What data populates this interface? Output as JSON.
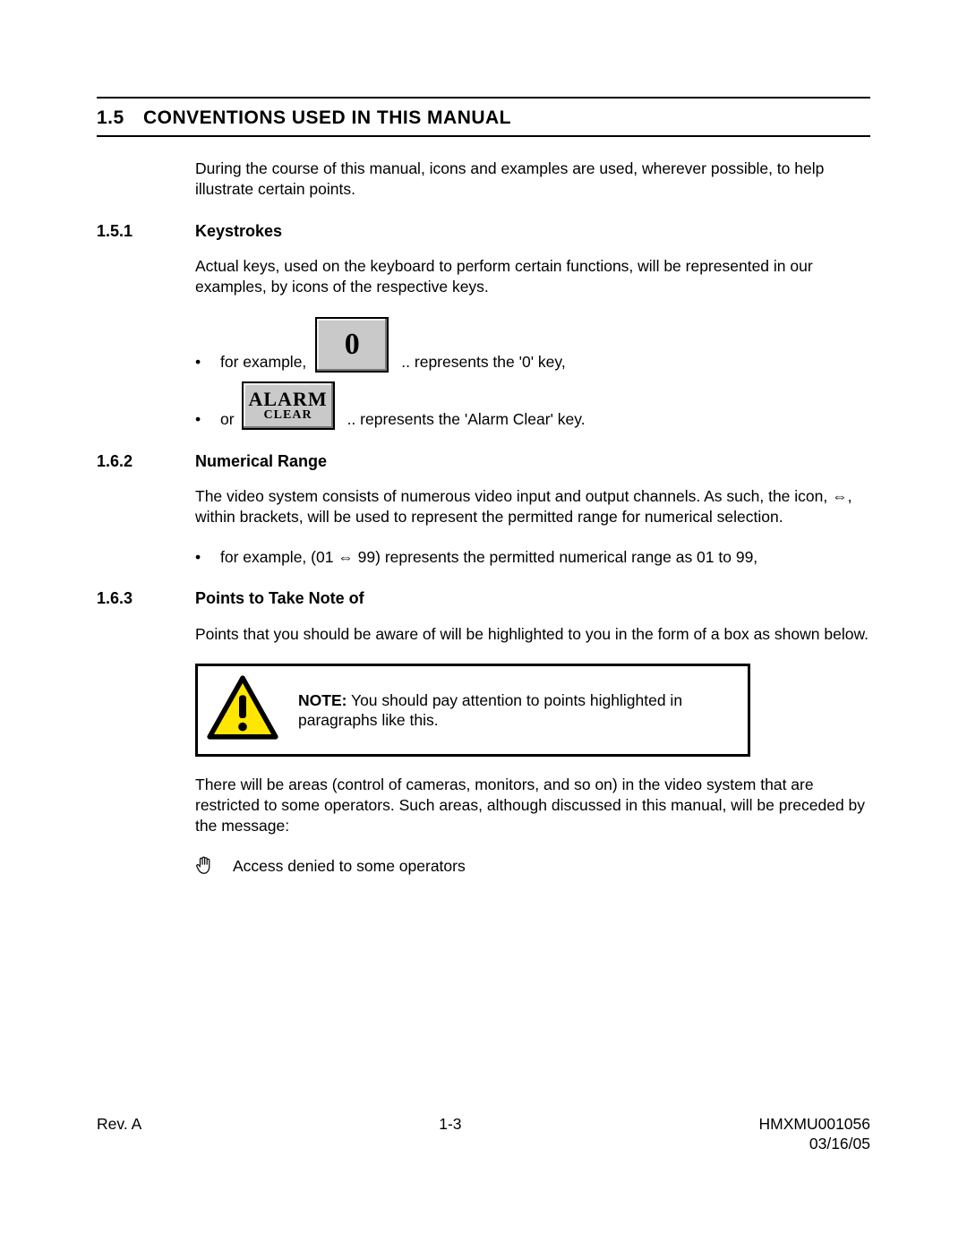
{
  "section": {
    "number": "1.5",
    "title": "CONVENTIONS USED IN THIS MANUAL",
    "intro": "During the course of this manual, icons and examples are used, wherever possible, to help illustrate certain points."
  },
  "sub1": {
    "number": "1.5.1",
    "title": "Keystrokes",
    "para": "Actual keys, used on the keyboard to perform certain functions, will be represented in our examples, by icons of the respective keys.",
    "b1_pre": "for example,",
    "key0": "0",
    "b1_post": ".. represents the '0' key,",
    "b2_pre": "or",
    "alarm_l1": "ALARM",
    "alarm_l2": "CLEAR",
    "b2_post": ".. represents the 'Alarm Clear' key."
  },
  "sub2": {
    "number": "1.6.2",
    "title": "Numerical Range",
    "para": "The  video system consists of numerous video input and output channels.  As such, the icon, ⇔, within brackets, will be used to represent the permitted range for numerical selection.",
    "b1": "for example,  (01 ⇔ 99) represents the permitted numerical range as 01 to 99,"
  },
  "sub3": {
    "number": "1.6.3",
    "title": "Points to Take Note of",
    "para": "Points that you should be aware of will be highlighted to you in the form of a box as shown below.",
    "note_label": "NOTE:",
    "note_body": "  You should pay attention to points highlighted in paragraphs like this.",
    "after_note": "There will be areas (control of cameras, monitors, and so on) in the video system that are restricted to some operators.  Such areas, although discussed in this manual, will be preceded by the message:",
    "access": "Access denied to some operators"
  },
  "footer": {
    "left": "Rev. A",
    "center": "1-3",
    "doc": "HMXMU001056",
    "date": "03/16/05"
  }
}
